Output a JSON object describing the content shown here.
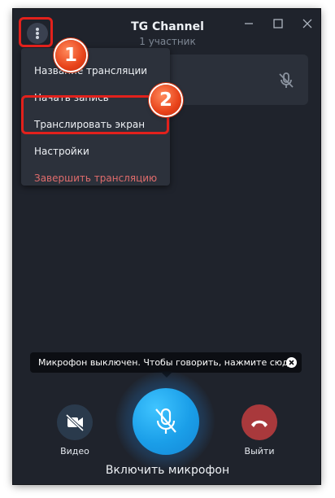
{
  "header": {
    "title": "TG Channel",
    "subtitle": "1 участник"
  },
  "window_controls": {
    "minimize_icon": "minimize-icon",
    "maximize_icon": "maximize-icon",
    "close_icon": "close-icon"
  },
  "menu": {
    "button_icon": "more-vertical-icon",
    "items": [
      {
        "label": "Название трансляции",
        "color": "#eef1f5"
      },
      {
        "label": "Начать запись",
        "color": "#eef1f5"
      },
      {
        "label": "Транслировать экран",
        "color": "#eef1f5"
      },
      {
        "label": "Настройки",
        "color": "#eef1f5"
      },
      {
        "label": "Завершить трансляцию",
        "color": "#e06c6c"
      }
    ]
  },
  "participant": {
    "mic_icon": "mic-off-icon"
  },
  "annotations": {
    "badge1": "1",
    "badge2": "2",
    "highlight_color": "#e2211c"
  },
  "tooltip": {
    "text": "Микрофон выключен. Чтобы говорить, нажмите сюда.",
    "close_icon": "close-circle-icon"
  },
  "controls": {
    "video_label": "Видео",
    "video_icon": "video-off-icon",
    "mic_label": "Включить микрофон",
    "mic_icon": "mic-off-icon",
    "leave_label": "Выйти",
    "leave_icon": "phone-hangup-icon",
    "mic_color": "#1a9ee8",
    "leave_color": "#a9393c",
    "video_color": "#2a3a4c"
  },
  "colors": {
    "window_bg": "#1f232c",
    "panel_bg": "#2c313b"
  }
}
